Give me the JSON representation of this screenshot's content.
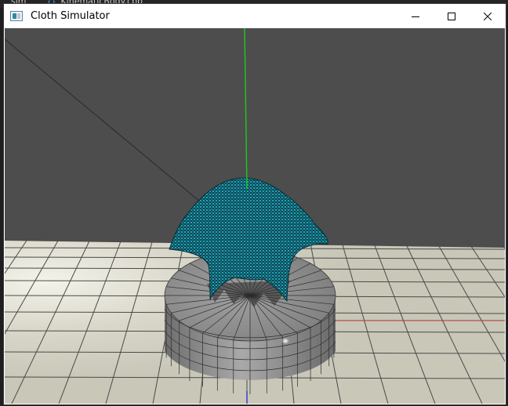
{
  "background_editor": {
    "breadcrumb_1": "sim",
    "breadcrumb_2": "KinematicBody.cpp"
  },
  "window": {
    "title": "Cloth Simulator",
    "icon": "application-icon",
    "controls": [
      "minimize-icon",
      "maximize-icon",
      "close-icon"
    ]
  },
  "scene": {
    "background_color": "#4d4d4d",
    "floor_color": "#d8d6c8",
    "grid_line_color": "#4a4a4a",
    "cloth_color": "#1aa8c0",
    "cloth_mesh_color": "#0a2e36",
    "pedestal_color": "#8e8e8e",
    "y_axis_color": "#1fc41f",
    "x_axis_color": "#b03030",
    "z_axis_color": "#3a3acc"
  }
}
